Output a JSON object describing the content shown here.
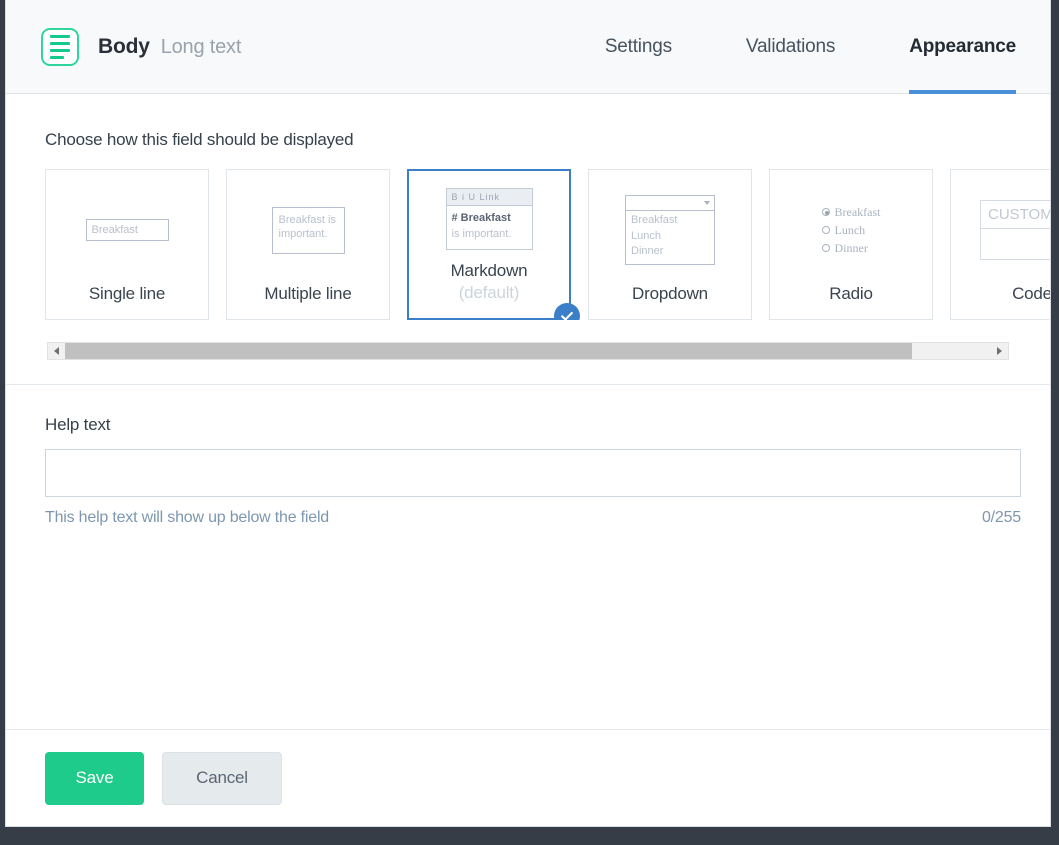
{
  "header": {
    "icon_name": "long-text-field-icon",
    "title": "Body",
    "subtitle": "Long text",
    "tabs": [
      {
        "label": "Settings",
        "active": false
      },
      {
        "label": "Validations",
        "active": false
      },
      {
        "label": "Appearance",
        "active": true
      }
    ],
    "active_tab_underline_color": "#4a90d9",
    "icon_color": "#17c98a"
  },
  "display": {
    "section_label": "Choose how this field should be displayed",
    "selected_card": "Markdown",
    "selected_border_color": "#3c7fc9",
    "cards": [
      {
        "label": "Single line",
        "sublabel": "",
        "preview_type": "single-line",
        "preview_text": "Breakfast"
      },
      {
        "label": "Multiple line",
        "sublabel": "",
        "preview_type": "multi-line",
        "preview_line1": "Breakfast is",
        "preview_line2": "important."
      },
      {
        "label": "Markdown",
        "sublabel": "(default)",
        "preview_type": "markdown",
        "toolbar": "B  i  U  Link",
        "heading": "# Breakfast",
        "paragraph": "is important."
      },
      {
        "label": "Dropdown",
        "sublabel": "",
        "preview_type": "dropdown",
        "options": [
          "Breakfast",
          "Lunch",
          "Dinner"
        ]
      },
      {
        "label": "Radio",
        "sublabel": "",
        "preview_type": "radio",
        "options": [
          "Breakfast",
          "Lunch",
          "Dinner"
        ],
        "selected_option": "Breakfast"
      },
      {
        "label": "Code",
        "sublabel": "",
        "preview_type": "code",
        "preview_text": "CUSTOM"
      }
    ],
    "scrollbar": {
      "left_arrow": "scroll-left-arrow",
      "right_arrow": "scroll-right-arrow",
      "thumb_fraction": "0.915"
    }
  },
  "help": {
    "label": "Help text",
    "value": "",
    "placeholder": "",
    "hint": "This help text will show up below the field",
    "counter": "0/255"
  },
  "footer": {
    "save_label": "Save",
    "cancel_label": "Cancel",
    "save_color": "#1ecb8b",
    "cancel_color": "#e5eaed"
  }
}
